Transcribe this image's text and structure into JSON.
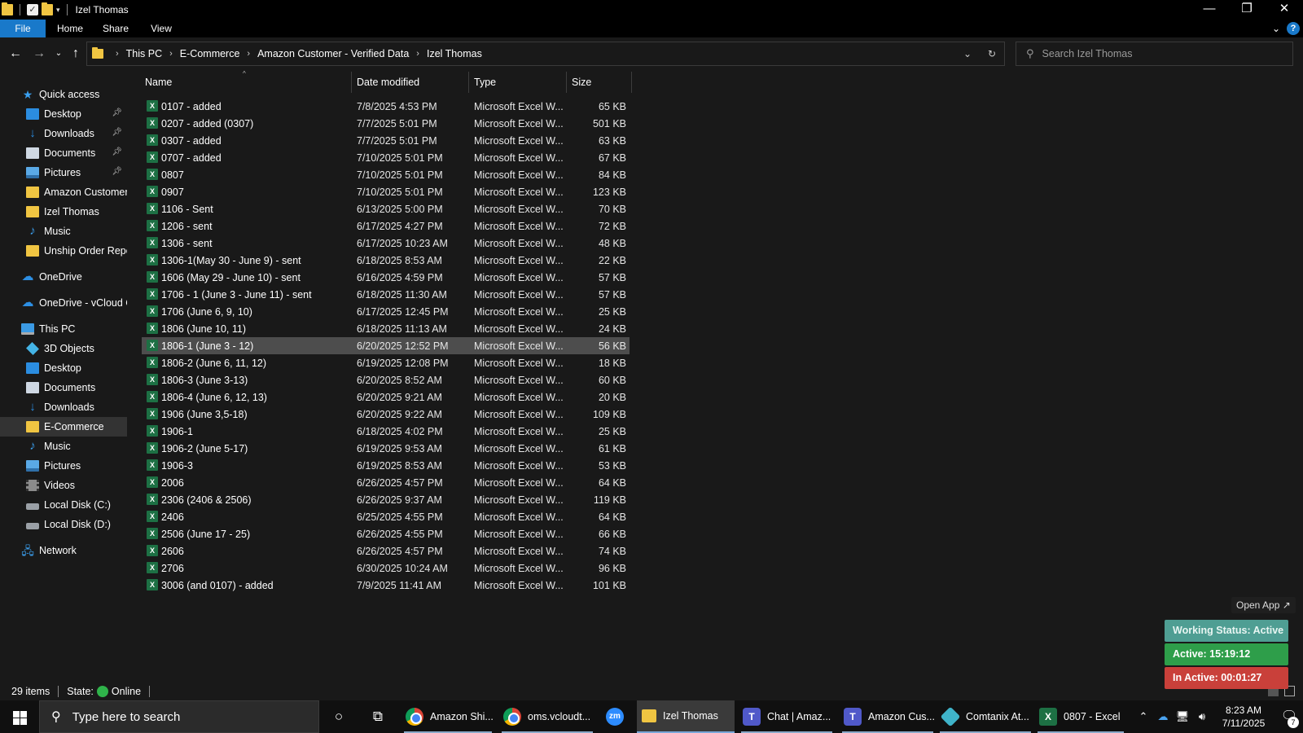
{
  "window": {
    "title": "Izel Thomas",
    "controls": {
      "minimize": "—",
      "restore": "❐",
      "close": "✕"
    }
  },
  "ribbon": {
    "tabs": [
      "File",
      "Home",
      "Share",
      "View"
    ],
    "help": "?"
  },
  "address": {
    "breadcrumb": [
      "This PC",
      "E-Commerce",
      "Amazon Customer - Verified Data",
      "Izel Thomas"
    ],
    "search_placeholder": "Search Izel Thomas"
  },
  "sidebar": {
    "quick_access": "Quick access",
    "quick_items": [
      {
        "label": "Desktop",
        "icon": "desktop-icon",
        "pinned": true
      },
      {
        "label": "Downloads",
        "icon": "downloads-icon",
        "pinned": true
      },
      {
        "label": "Documents",
        "icon": "documents-icon",
        "pinned": true
      },
      {
        "label": "Pictures",
        "icon": "pictures-icon",
        "pinned": true
      },
      {
        "label": "Amazon Customer",
        "icon": "folder-icon",
        "pinned": false
      },
      {
        "label": "Izel Thomas",
        "icon": "folder-icon",
        "pinned": false
      },
      {
        "label": "Music",
        "icon": "music-icon",
        "pinned": false
      },
      {
        "label": "Unship Order Repor",
        "icon": "folder-icon",
        "pinned": false
      }
    ],
    "onedrive": "OneDrive",
    "onedrive_vcloud": "OneDrive - vCloud Cl",
    "this_pc": "This PC",
    "pc_items": [
      {
        "label": "3D Objects",
        "icon": "3d-objects-icon"
      },
      {
        "label": "Desktop",
        "icon": "desktop-icon"
      },
      {
        "label": "Documents",
        "icon": "documents-icon"
      },
      {
        "label": "Downloads",
        "icon": "downloads-icon"
      },
      {
        "label": "E-Commerce",
        "icon": "folder-icon",
        "selected": true
      },
      {
        "label": "Music",
        "icon": "music-icon"
      },
      {
        "label": "Pictures",
        "icon": "pictures-icon"
      },
      {
        "label": "Videos",
        "icon": "videos-icon"
      },
      {
        "label": "Local Disk (C:)",
        "icon": "disk-icon"
      },
      {
        "label": "Local Disk (D:)",
        "icon": "disk-icon"
      }
    ],
    "network": "Network"
  },
  "columns": {
    "name": "Name",
    "date": "Date modified",
    "type": "Type",
    "size": "Size"
  },
  "files": [
    {
      "name": "0107 - added",
      "date": "7/8/2025 4:53 PM",
      "type": "Microsoft Excel W...",
      "size": "65 KB"
    },
    {
      "name": "0207 - added (0307)",
      "date": "7/7/2025 5:01 PM",
      "type": "Microsoft Excel W...",
      "size": "501 KB"
    },
    {
      "name": "0307 - added",
      "date": "7/7/2025 5:01 PM",
      "type": "Microsoft Excel W...",
      "size": "63 KB"
    },
    {
      "name": "0707 - added",
      "date": "7/10/2025 5:01 PM",
      "type": "Microsoft Excel W...",
      "size": "67 KB"
    },
    {
      "name": "0807",
      "date": "7/10/2025 5:01 PM",
      "type": "Microsoft Excel W...",
      "size": "84 KB"
    },
    {
      "name": "0907",
      "date": "7/10/2025 5:01 PM",
      "type": "Microsoft Excel W...",
      "size": "123 KB"
    },
    {
      "name": "1106 - Sent",
      "date": "6/13/2025 5:00 PM",
      "type": "Microsoft Excel W...",
      "size": "70 KB"
    },
    {
      "name": "1206 - sent",
      "date": "6/17/2025 4:27 PM",
      "type": "Microsoft Excel W...",
      "size": "72 KB"
    },
    {
      "name": "1306 - sent",
      "date": "6/17/2025 10:23 AM",
      "type": "Microsoft Excel W...",
      "size": "48 KB"
    },
    {
      "name": "1306-1(May 30 - June 9) - sent",
      "date": "6/18/2025 8:53 AM",
      "type": "Microsoft Excel W...",
      "size": "22 KB"
    },
    {
      "name": "1606 (May 29 - June 10) - sent",
      "date": "6/16/2025 4:59 PM",
      "type": "Microsoft Excel W...",
      "size": "57 KB"
    },
    {
      "name": "1706 - 1 (June 3 - June 11) - sent",
      "date": "6/18/2025 11:30 AM",
      "type": "Microsoft Excel W...",
      "size": "57 KB"
    },
    {
      "name": "1706 (June 6, 9, 10)",
      "date": "6/17/2025 12:45 PM",
      "type": "Microsoft Excel W...",
      "size": "25 KB"
    },
    {
      "name": "1806 (June 10, 11)",
      "date": "6/18/2025 11:13 AM",
      "type": "Microsoft Excel W...",
      "size": "24 KB"
    },
    {
      "name": "1806-1 (June 3 - 12)",
      "date": "6/20/2025 12:52 PM",
      "type": "Microsoft Excel W...",
      "size": "56 KB",
      "selected": true
    },
    {
      "name": "1806-2 (June 6, 11, 12)",
      "date": "6/19/2025 12:08 PM",
      "type": "Microsoft Excel W...",
      "size": "18 KB"
    },
    {
      "name": "1806-3 (June 3-13)",
      "date": "6/20/2025 8:52 AM",
      "type": "Microsoft Excel W...",
      "size": "60 KB"
    },
    {
      "name": "1806-4 (June 6, 12, 13)",
      "date": "6/20/2025 9:21 AM",
      "type": "Microsoft Excel W...",
      "size": "20 KB"
    },
    {
      "name": "1906 (June 3,5-18)",
      "date": "6/20/2025 9:22 AM",
      "type": "Microsoft Excel W...",
      "size": "109 KB"
    },
    {
      "name": "1906-1",
      "date": "6/18/2025 4:02 PM",
      "type": "Microsoft Excel W...",
      "size": "25 KB"
    },
    {
      "name": "1906-2 (June 5-17)",
      "date": "6/19/2025 9:53 AM",
      "type": "Microsoft Excel W...",
      "size": "61 KB"
    },
    {
      "name": "1906-3",
      "date": "6/19/2025 8:53 AM",
      "type": "Microsoft Excel W...",
      "size": "53 KB"
    },
    {
      "name": "2006",
      "date": "6/26/2025 4:57 PM",
      "type": "Microsoft Excel W...",
      "size": "64 KB"
    },
    {
      "name": "2306 (2406 & 2506)",
      "date": "6/26/2025 9:37 AM",
      "type": "Microsoft Excel W...",
      "size": "119 KB"
    },
    {
      "name": "2406",
      "date": "6/25/2025 4:55 PM",
      "type": "Microsoft Excel W...",
      "size": "64 KB"
    },
    {
      "name": "2506 (June 17 - 25)",
      "date": "6/26/2025 4:55 PM",
      "type": "Microsoft Excel W...",
      "size": "66 KB"
    },
    {
      "name": "2606",
      "date": "6/26/2025 4:57 PM",
      "type": "Microsoft Excel W...",
      "size": "74 KB"
    },
    {
      "name": "2706",
      "date": "6/30/2025 10:24 AM",
      "type": "Microsoft Excel W...",
      "size": "96 KB"
    },
    {
      "name": "3006 (and 0107) - added",
      "date": "7/9/2025 11:41 AM",
      "type": "Microsoft Excel W...",
      "size": "101 KB"
    }
  ],
  "status": {
    "count": "29 items",
    "state_label": "State:",
    "state_value": "Online"
  },
  "widget": {
    "open_app": "Open App ↗",
    "working_status": "Working Status: Active",
    "active": "Active: 15:19:12",
    "inactive": "In Active: 00:01:27"
  },
  "taskbar": {
    "search_placeholder": "Type here to search",
    "apps": [
      {
        "label": "Amazon Shi...",
        "icon": "chrome-icon"
      },
      {
        "label": "oms.vcloudt...",
        "icon": "chrome-icon"
      },
      {
        "label": "",
        "icon": "zoom-icon"
      },
      {
        "label": "Izel Thomas",
        "icon": "folder-icon",
        "active": true
      },
      {
        "label": "Chat | Amaz...",
        "icon": "teams-icon"
      },
      {
        "label": "Amazon Cus...",
        "icon": "teams-icon"
      },
      {
        "label": "Comtanix At...",
        "icon": "comtanix-icon"
      },
      {
        "label": "0807 - Excel",
        "icon": "excel-icon"
      }
    ],
    "time": "8:23 AM",
    "date": "7/11/2025",
    "notification_count": "7"
  }
}
